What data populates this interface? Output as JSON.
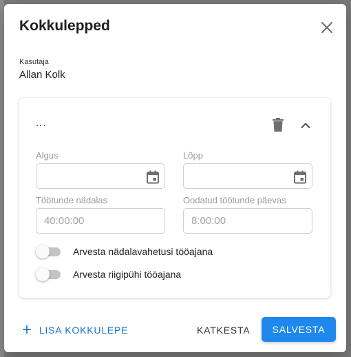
{
  "dialog": {
    "title": "Kokkulepped",
    "close_icon": "close-icon"
  },
  "user": {
    "label": "Kasutaja",
    "value": "Allan Kolk"
  },
  "agreement": {
    "name": "...",
    "delete_icon": "trash-icon",
    "collapse_icon": "chevron-up-icon",
    "start": {
      "label": "Algus",
      "value": "",
      "icon": "calendar-icon"
    },
    "end": {
      "label": "Lõpp",
      "value": "",
      "icon": "calendar-icon"
    },
    "weekly_hours": {
      "label": "Töötunde nädalas",
      "value": "",
      "placeholder": "40:00:00"
    },
    "daily_hours": {
      "label": "Oodatud töötunde päevas",
      "value": "",
      "placeholder": "8:00:00"
    },
    "toggles": [
      {
        "label": "Arvesta nädalavahetusi tööajana",
        "checked": false
      },
      {
        "label": "Arvesta riigipühi tööajana",
        "checked": false
      }
    ]
  },
  "actions": {
    "add_label": "LISA KOKKULEPE",
    "add_icon": "plus-icon",
    "cancel_label": "KATKESTA",
    "save_label": "SALVESTA"
  },
  "colors": {
    "primary": "#1e88ef",
    "link": "#1976d2",
    "toggle_off_track": "#c4c4c4"
  }
}
